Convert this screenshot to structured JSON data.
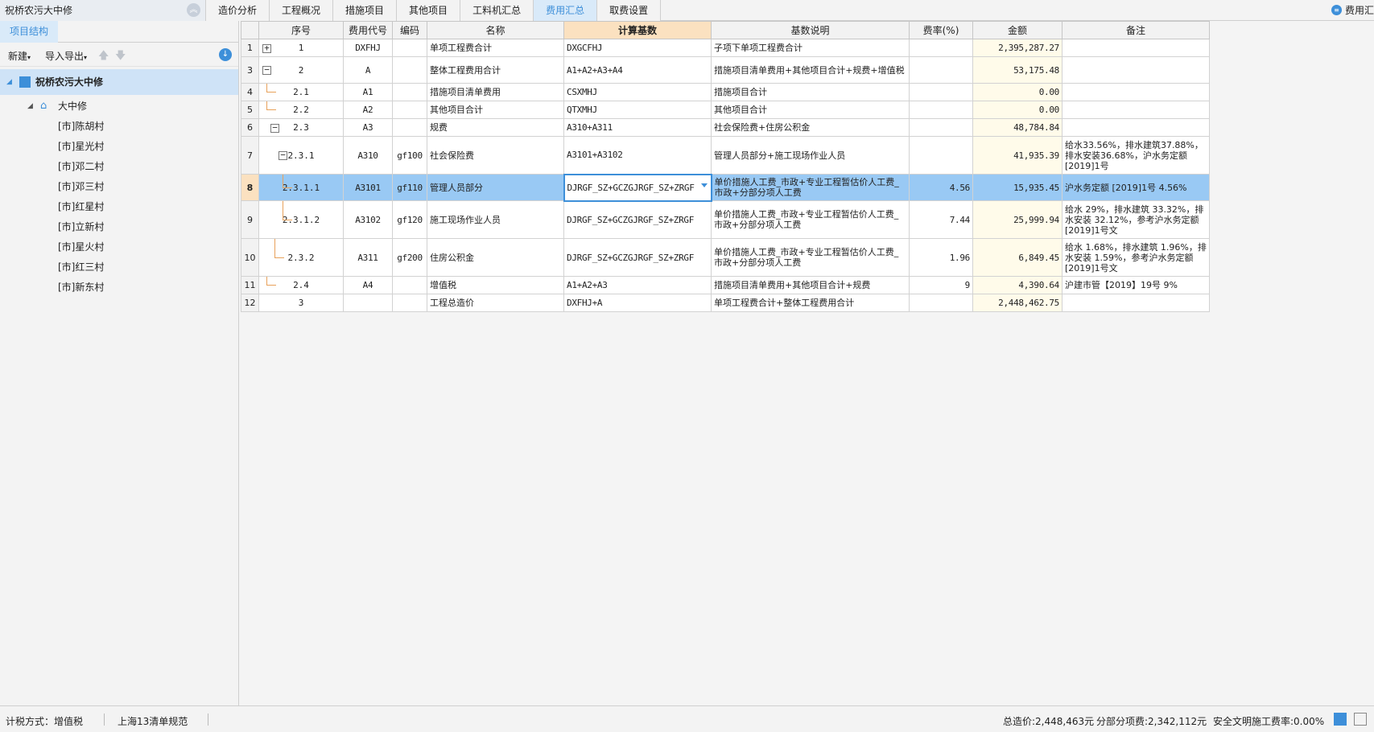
{
  "app": {
    "project_title": "祝桥农污大中修",
    "top_right_label": "费用汇"
  },
  "tabs": [
    "造价分析",
    "工程概况",
    "措施项目",
    "其他项目",
    "工料机汇总",
    "费用汇总",
    "取费设置"
  ],
  "tabs_active_index": 5,
  "left_panel": {
    "tab": "项目结构",
    "toolbar": {
      "new": "新建",
      "import_export": "导入导出"
    },
    "tree": {
      "root": "祝桥农污大中修",
      "node": "大中修",
      "leaves": [
        "[市]陈胡村",
        "[市]星光村",
        "[市]邓二村",
        "[市]邓三村",
        "[市]红星村",
        "[市]立新村",
        "[市]星火村",
        "[市]红三村",
        "[市]新东村"
      ]
    }
  },
  "grid": {
    "headers": [
      "序号",
      "费用代号",
      "编码",
      "名称",
      "计算基数",
      "基数说明",
      "费率(%)",
      "金额",
      "备注"
    ],
    "rows": [
      {
        "rn": "1",
        "seq": "1",
        "daihao": "DXFHJ",
        "bianma": "",
        "name": "单项工程费合计",
        "base": "DXGCFHJ",
        "desc": "子项下单项工程费合计",
        "rate": "",
        "amount": "2,395,287.27",
        "note": ""
      },
      {
        "rn": "3",
        "seq": "2",
        "daihao": "A",
        "bianma": "",
        "name": "整体工程费用合计",
        "base": "A1+A2+A3+A4",
        "desc": "措施项目清单费用+其他项目合计+规费+增值税",
        "rate": "",
        "amount": "53,175.48",
        "note": ""
      },
      {
        "rn": "4",
        "seq": "2.1",
        "daihao": "A1",
        "bianma": "",
        "name": "措施项目清单费用",
        "base": "CSXMHJ",
        "desc": "措施项目合计",
        "rate": "",
        "amount": "0.00",
        "note": ""
      },
      {
        "rn": "5",
        "seq": "2.2",
        "daihao": "A2",
        "bianma": "",
        "name": "其他项目合计",
        "base": "QTXMHJ",
        "desc": "其他项目合计",
        "rate": "",
        "amount": "0.00",
        "note": ""
      },
      {
        "rn": "6",
        "seq": "2.3",
        "daihao": "A3",
        "bianma": "",
        "name": "规费",
        "base": "A310+A311",
        "desc": "社会保险费+住房公积金",
        "rate": "",
        "amount": "48,784.84",
        "note": ""
      },
      {
        "rn": "7",
        "seq": "2.3.1",
        "daihao": "A310",
        "bianma": "gf100",
        "name": "社会保险费",
        "base": "A3101+A3102",
        "desc": "管理人员部分+施工现场作业人员",
        "rate": "",
        "amount": "41,935.39",
        "note": "给水33.56%，排水建筑37.88%，排水安装36.68%，沪水务定额[2019]1号"
      },
      {
        "rn": "8",
        "seq": "2.3.1.1",
        "daihao": "A3101",
        "bianma": "gf110",
        "name": "管理人员部分",
        "base": "DJRGF_SZ+GCZGJRGF_SZ+ZRGF",
        "desc": "单价措施人工费_市政+专业工程暂估价人工费_市政+分部分项人工费",
        "rate": "4.56",
        "amount": "15,935.45",
        "note": "沪水务定额 [2019]1号 4.56%"
      },
      {
        "rn": "9",
        "seq": "2.3.1.2",
        "daihao": "A3102",
        "bianma": "gf120",
        "name": "施工现场作业人员",
        "base": "DJRGF_SZ+GCZGJRGF_SZ+ZRGF",
        "desc": "单价措施人工费_市政+专业工程暂估价人工费_市政+分部分项人工费",
        "rate": "7.44",
        "amount": "25,999.94",
        "note": "给水 29%，排水建筑 33.32%，排水安装 32.12%，参考沪水务定额[2019]1号文"
      },
      {
        "rn": "10",
        "seq": "2.3.2",
        "daihao": "A311",
        "bianma": "gf200",
        "name": "住房公积金",
        "base": "DJRGF_SZ+GCZGJRGF_SZ+ZRGF",
        "desc": "单价措施人工费_市政+专业工程暂估价人工费_市政+分部分项人工费",
        "rate": "1.96",
        "amount": "6,849.45",
        "note": "给水 1.68%，排水建筑 1.96%，排水安装 1.59%，参考沪水务定额 [2019]1号文"
      },
      {
        "rn": "11",
        "seq": "2.4",
        "daihao": "A4",
        "bianma": "",
        "name": "增值税",
        "base": "A1+A2+A3",
        "desc": "措施项目清单费用+其他项目合计+规费",
        "rate": "9",
        "amount": "4,390.64",
        "note": "沪建市管【2019】19号 9%"
      },
      {
        "rn": "12",
        "seq": "3",
        "daihao": "",
        "bianma": "",
        "name": "工程总造价",
        "base": "DXFHJ+A",
        "desc": "单项工程费合计+整体工程费用合计",
        "rate": "",
        "amount": "2,448,462.75",
        "note": ""
      }
    ]
  },
  "status": {
    "tax_mode": "计税方式：增值税",
    "spec": "上海13清单规范",
    "total": "总造价:2,448,463元",
    "subtotal": "分部分项费:2,342,112元",
    "safety_rate": "安全文明施工费率:0.00%"
  },
  "colors": {
    "accent": "#3d8fd9",
    "selected_row": "#99c9f4",
    "header_highlight": "#fbe1c0",
    "amount_bg": "#fffbea",
    "tree_line": "#e8a15a"
  }
}
